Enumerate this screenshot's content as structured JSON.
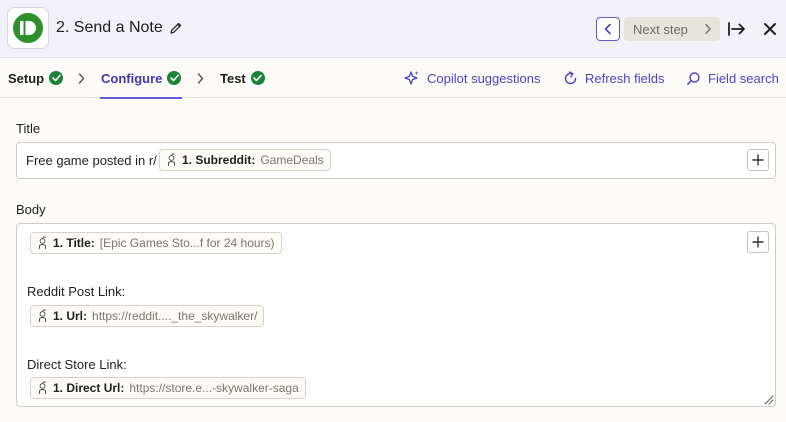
{
  "header": {
    "step_title": "2. Send a Note",
    "next_step_label": "Next step"
  },
  "tabs": [
    {
      "label": "Setup",
      "status": "complete"
    },
    {
      "label": "Configure",
      "status": "complete",
      "active": true
    },
    {
      "label": "Test",
      "status": "complete"
    }
  ],
  "tools": {
    "copilot": "Copilot suggestions",
    "refresh": "Refresh fields",
    "search": "Field search"
  },
  "fields": {
    "title": {
      "label": "Title",
      "prefix_text": "Free game posted in r/",
      "pill": {
        "name": "1. Subreddit:",
        "value": "GameDeals"
      }
    },
    "body": {
      "label": "Body",
      "pill_title": {
        "name": "1. Title:",
        "value": "[Epic Games Sto...f for 24 hours)"
      },
      "reddit_label": "Reddit Post Link:",
      "pill_url": {
        "name": "1. Url:",
        "value": "https://reddit...._the_skywalker/"
      },
      "store_label": "Direct Store Link:",
      "pill_direct": {
        "name": "1. Direct Url:",
        "value": "https://store.e...-skywalker-saga"
      }
    }
  },
  "colors": {
    "accent": "#5f5bd6",
    "accent_text": "#4a44c6",
    "success": "#198438",
    "app_green": "#2f8f2f"
  }
}
